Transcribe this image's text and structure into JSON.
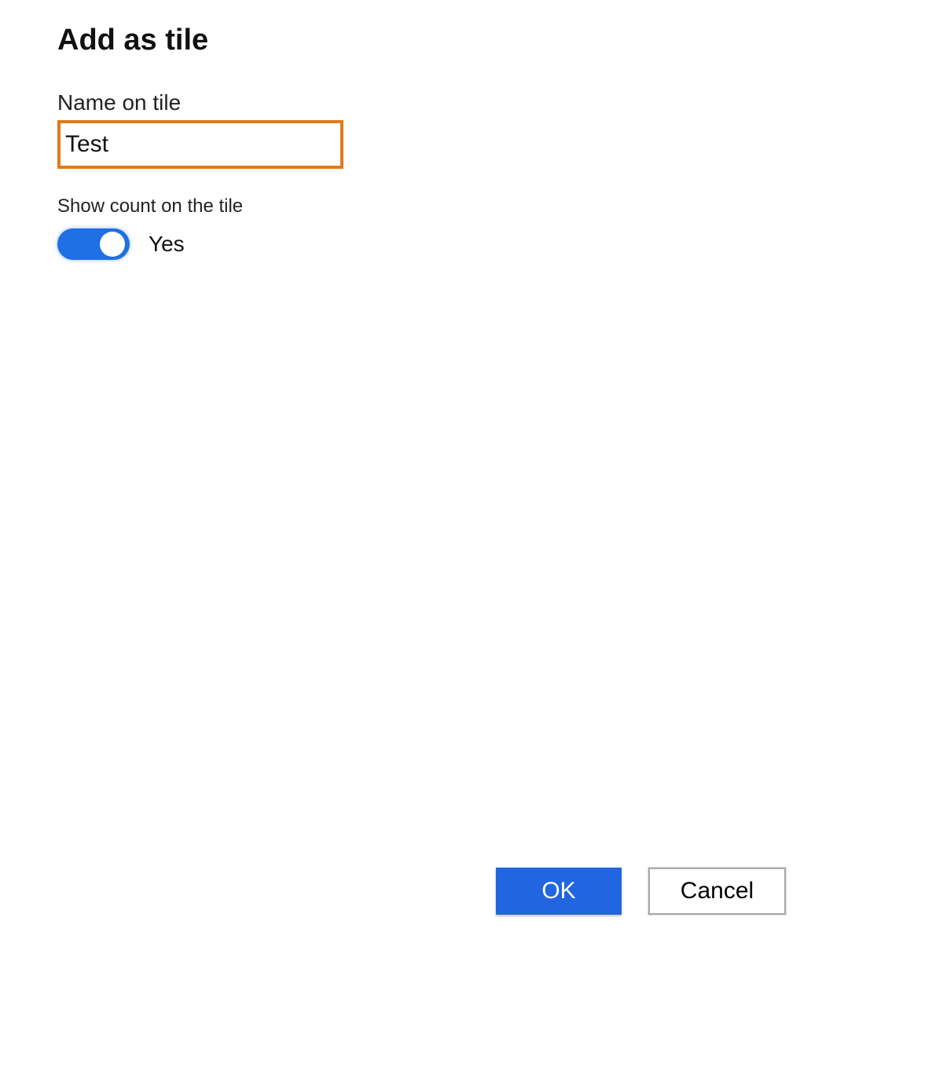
{
  "dialog": {
    "title": "Add as tile"
  },
  "fields": {
    "name_label": "Name on tile",
    "name_value": "Test",
    "show_count_label": "Show count on the tile",
    "toggle_state": "on",
    "toggle_value_label": "Yes"
  },
  "buttons": {
    "ok_label": "OK",
    "cancel_label": "Cancel"
  },
  "colors": {
    "accent": "#2166e0",
    "input_border_focus": "#e07a1a"
  }
}
